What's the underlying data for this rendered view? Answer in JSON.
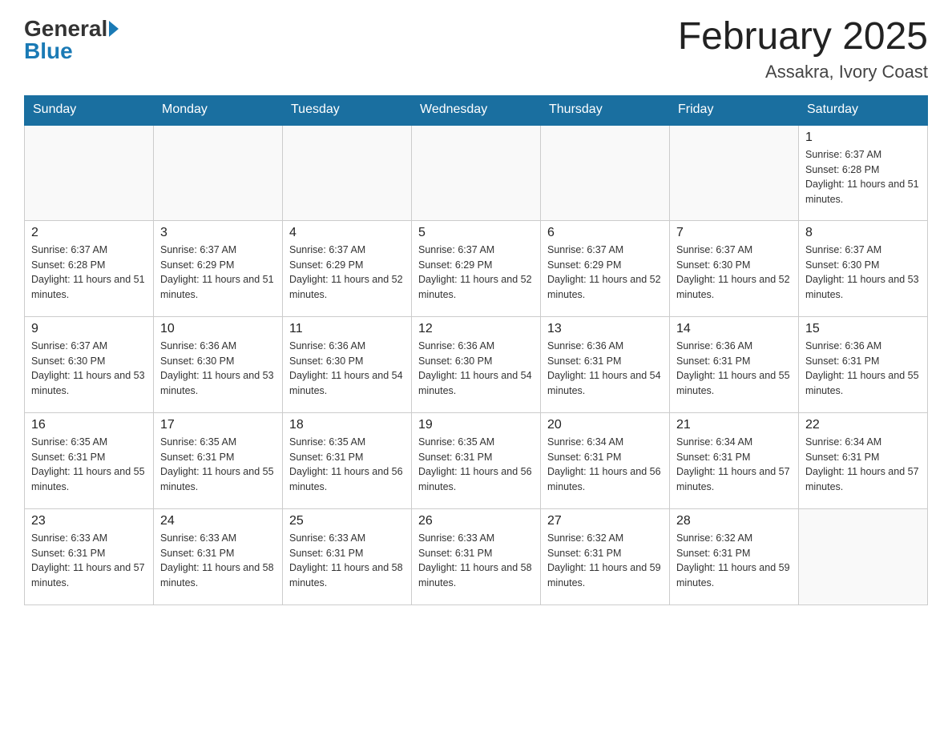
{
  "header": {
    "logo_general": "General",
    "logo_blue": "Blue",
    "month_title": "February 2025",
    "location": "Assakra, Ivory Coast"
  },
  "days_of_week": [
    "Sunday",
    "Monday",
    "Tuesday",
    "Wednesday",
    "Thursday",
    "Friday",
    "Saturday"
  ],
  "weeks": [
    {
      "cells": [
        {
          "day": "",
          "info": ""
        },
        {
          "day": "",
          "info": ""
        },
        {
          "day": "",
          "info": ""
        },
        {
          "day": "",
          "info": ""
        },
        {
          "day": "",
          "info": ""
        },
        {
          "day": "",
          "info": ""
        },
        {
          "day": "1",
          "info": "Sunrise: 6:37 AM\nSunset: 6:28 PM\nDaylight: 11 hours and 51 minutes."
        }
      ]
    },
    {
      "cells": [
        {
          "day": "2",
          "info": "Sunrise: 6:37 AM\nSunset: 6:28 PM\nDaylight: 11 hours and 51 minutes."
        },
        {
          "day": "3",
          "info": "Sunrise: 6:37 AM\nSunset: 6:29 PM\nDaylight: 11 hours and 51 minutes."
        },
        {
          "day": "4",
          "info": "Sunrise: 6:37 AM\nSunset: 6:29 PM\nDaylight: 11 hours and 52 minutes."
        },
        {
          "day": "5",
          "info": "Sunrise: 6:37 AM\nSunset: 6:29 PM\nDaylight: 11 hours and 52 minutes."
        },
        {
          "day": "6",
          "info": "Sunrise: 6:37 AM\nSunset: 6:29 PM\nDaylight: 11 hours and 52 minutes."
        },
        {
          "day": "7",
          "info": "Sunrise: 6:37 AM\nSunset: 6:30 PM\nDaylight: 11 hours and 52 minutes."
        },
        {
          "day": "8",
          "info": "Sunrise: 6:37 AM\nSunset: 6:30 PM\nDaylight: 11 hours and 53 minutes."
        }
      ]
    },
    {
      "cells": [
        {
          "day": "9",
          "info": "Sunrise: 6:37 AM\nSunset: 6:30 PM\nDaylight: 11 hours and 53 minutes."
        },
        {
          "day": "10",
          "info": "Sunrise: 6:36 AM\nSunset: 6:30 PM\nDaylight: 11 hours and 53 minutes."
        },
        {
          "day": "11",
          "info": "Sunrise: 6:36 AM\nSunset: 6:30 PM\nDaylight: 11 hours and 54 minutes."
        },
        {
          "day": "12",
          "info": "Sunrise: 6:36 AM\nSunset: 6:30 PM\nDaylight: 11 hours and 54 minutes."
        },
        {
          "day": "13",
          "info": "Sunrise: 6:36 AM\nSunset: 6:31 PM\nDaylight: 11 hours and 54 minutes."
        },
        {
          "day": "14",
          "info": "Sunrise: 6:36 AM\nSunset: 6:31 PM\nDaylight: 11 hours and 55 minutes."
        },
        {
          "day": "15",
          "info": "Sunrise: 6:36 AM\nSunset: 6:31 PM\nDaylight: 11 hours and 55 minutes."
        }
      ]
    },
    {
      "cells": [
        {
          "day": "16",
          "info": "Sunrise: 6:35 AM\nSunset: 6:31 PM\nDaylight: 11 hours and 55 minutes."
        },
        {
          "day": "17",
          "info": "Sunrise: 6:35 AM\nSunset: 6:31 PM\nDaylight: 11 hours and 55 minutes."
        },
        {
          "day": "18",
          "info": "Sunrise: 6:35 AM\nSunset: 6:31 PM\nDaylight: 11 hours and 56 minutes."
        },
        {
          "day": "19",
          "info": "Sunrise: 6:35 AM\nSunset: 6:31 PM\nDaylight: 11 hours and 56 minutes."
        },
        {
          "day": "20",
          "info": "Sunrise: 6:34 AM\nSunset: 6:31 PM\nDaylight: 11 hours and 56 minutes."
        },
        {
          "day": "21",
          "info": "Sunrise: 6:34 AM\nSunset: 6:31 PM\nDaylight: 11 hours and 57 minutes."
        },
        {
          "day": "22",
          "info": "Sunrise: 6:34 AM\nSunset: 6:31 PM\nDaylight: 11 hours and 57 minutes."
        }
      ]
    },
    {
      "cells": [
        {
          "day": "23",
          "info": "Sunrise: 6:33 AM\nSunset: 6:31 PM\nDaylight: 11 hours and 57 minutes."
        },
        {
          "day": "24",
          "info": "Sunrise: 6:33 AM\nSunset: 6:31 PM\nDaylight: 11 hours and 58 minutes."
        },
        {
          "day": "25",
          "info": "Sunrise: 6:33 AM\nSunset: 6:31 PM\nDaylight: 11 hours and 58 minutes."
        },
        {
          "day": "26",
          "info": "Sunrise: 6:33 AM\nSunset: 6:31 PM\nDaylight: 11 hours and 58 minutes."
        },
        {
          "day": "27",
          "info": "Sunrise: 6:32 AM\nSunset: 6:31 PM\nDaylight: 11 hours and 59 minutes."
        },
        {
          "day": "28",
          "info": "Sunrise: 6:32 AM\nSunset: 6:31 PM\nDaylight: 11 hours and 59 minutes."
        },
        {
          "day": "",
          "info": ""
        }
      ]
    }
  ]
}
